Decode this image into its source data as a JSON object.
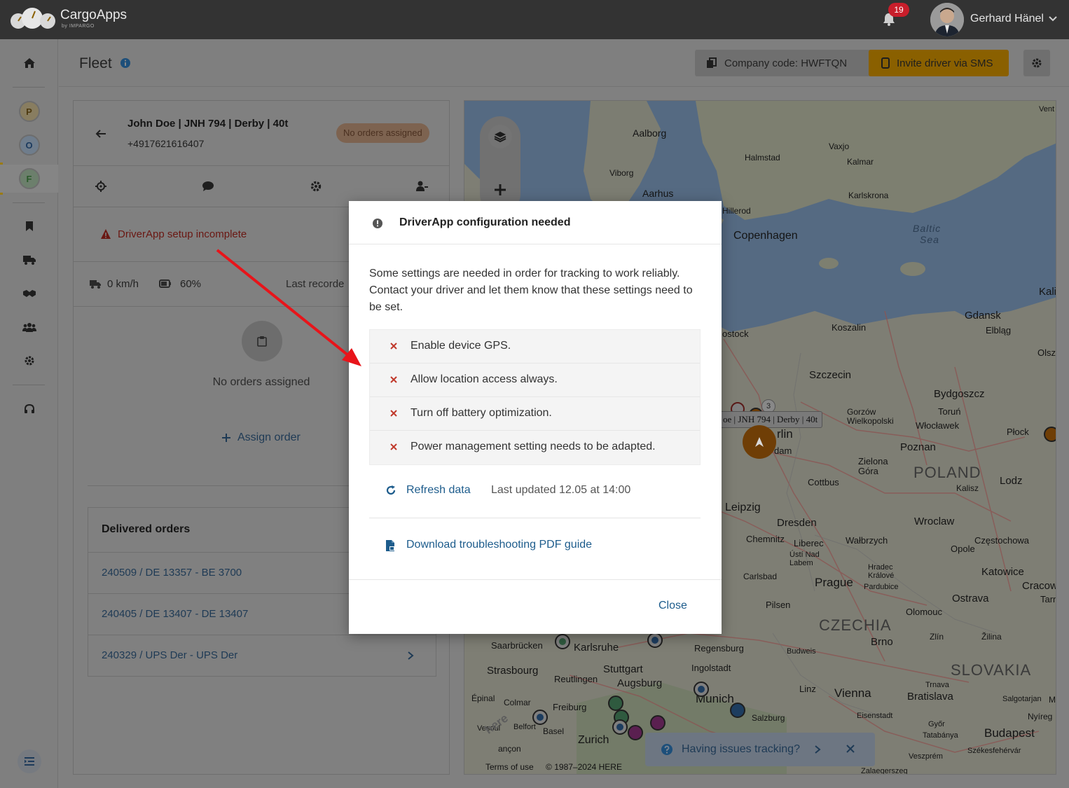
{
  "app": {
    "brand": "CargoApps",
    "brand_sub": "by IMPARGO",
    "notifications_count": "19",
    "user_name": "Gerhard Hänel"
  },
  "sidebar": {
    "letters": [
      {
        "label": "P",
        "color": "#7a6a3a"
      },
      {
        "label": "O",
        "color": "#2a4c6e"
      },
      {
        "label": "F",
        "color": "#3f6b3f"
      }
    ],
    "icons": [
      "home-icon",
      "bookmark-icon",
      "truck-icon",
      "handshake-icon",
      "users-icon",
      "gear-icon",
      "headset-icon",
      "collapse-menu-icon"
    ]
  },
  "header": {
    "title": "Fleet",
    "company_code_label": "Company code: HWFTQN",
    "invite_label": "Invite driver via SMS"
  },
  "panel": {
    "driver_title": "John Doe | JNH 794 | Derby | 40t",
    "phone": "+4917621616407",
    "status_chip": "No orders assigned",
    "warning": "DriverApp setup incomplete",
    "speed": "0 km/h",
    "battery": "60%",
    "last_recorded": "Last recorde",
    "no_orders": "No orders assigned",
    "assign_order": "Assign order",
    "delivered_title": "Delivered orders",
    "delivered_orders": [
      "240509 / DE 13357 - BE 3700",
      "240405 / DE 13407 - DE 13407",
      "240329 / UPS Der - UPS Der"
    ]
  },
  "map": {
    "labels": {
      "aalborg": "Aalborg",
      "viborg": "Viborg",
      "aarhus": "Aarhus",
      "vaxjo": "Vaxjo",
      "halmstad": "Halmstad",
      "kalmar": "Kalmar",
      "karlskrona": "Karlskrona",
      "hillerod": "Hillerod",
      "copenhagen": "Copenhagen",
      "baltic": "Baltic",
      "sea": "Sea",
      "kali": "Kali",
      "gdansk": "Gdansk",
      "elblag": "Elbląg",
      "koszalin": "Koszalin",
      "rostock": "ostock",
      "olsz": "Olszt",
      "szczecin": "Szczecin",
      "bydgoszcz": "Bydgoszcz",
      "gorzow": "Gorzów\nWielkopolski",
      "torun": "Toruń",
      "wloclawek": "Włocławek",
      "plock": "Płock",
      "berlin": "rlin",
      "poznan": "Poznan",
      "potsdam": "dam",
      "zielona": "Zielona\nGóra",
      "poland": "POLAND",
      "lodz": "Lodz",
      "kalisz": "Kalisz",
      "cottbus": "Cottbus",
      "leipzig": "Leipzig",
      "wroclaw": "Wroclaw",
      "dresden": "Dresden",
      "chemnitz": "Chemnitz",
      "liberec": "Liberec",
      "walbrzych": "Wałbrzych",
      "czestochowa": "Częstochowa",
      "opole": "Opole",
      "ustinad": "Ústí Nad\nLabem",
      "hradec": "Hradec\nKrálové",
      "pardubice": "Pardubice",
      "katowice": "Katowice",
      "cracow": "Cracow",
      "carlsbad": "Carlsbad",
      "prague": "Prague",
      "ostrava": "Ostrava",
      "tarn": "Tarn",
      "pilsen": "Pilsen",
      "olomouc": "Olomouc",
      "czechia": "CZECHIA",
      "brno": "Brno",
      "zlin": "Zlín",
      "zilina": "Žilina",
      "saarbrucken": "Saarbrücken",
      "karlsruhe": "Karlsruhe",
      "regensburg": "Regensburg",
      "budweis": "Budweis",
      "slovakia": "SLOVAKIA",
      "strasbourg": "Strasbourg",
      "stuttgart": "Stuttgart",
      "ingolstadt": "Ingolstadt",
      "reutlingen": "Reutlingen",
      "augsburg": "Augsburg",
      "linz": "Linz",
      "vienna": "Vienna",
      "trnava": "Trnava",
      "bratislava": "Bratislava",
      "salgotarjan": "Salgotarjan",
      "epinal": "Épinal",
      "colmar": "Colmar",
      "freiburg": "Freiburg",
      "munich": "Munich",
      "salzburg": "Salzburg",
      "eisenstadt": "Eisenstadt",
      "gyor": "Győr",
      "tatabanya": "Tatabánya",
      "budapest": "Budapest",
      "nyireg": "Nyíreg",
      "vesoul": "Vesoul",
      "belfort": "Belfort",
      "basel": "Basel",
      "zurich": "Zurich",
      "besancon": "ançon",
      "veszprem": "Veszprém",
      "szekesfehervar": "Székesfehérvár",
      "zalaegerszeg": "Zalaegerszeg",
      "vent": "Vent",
      "m": "M",
      "kalisz2": "Kalisz"
    },
    "cluster_count": "3",
    "vehicle_tooltip": "oe | JNH 794 | Derby | 40t",
    "terms": "Terms of use",
    "copyright": "© 1987–2024 HERE",
    "issues_label": "Having issues tracking?",
    "here_watermark": "here"
  },
  "modal": {
    "title": "DriverApp configuration needed",
    "body": "Some settings are needed in order for tracking to work reliably. Contact your driver and let them know that these settings need to be set.",
    "items": [
      "Enable device GPS.",
      "Allow location access always.",
      "Turn off battery optimization.",
      "Power management setting needs to be adapted."
    ],
    "refresh_label": "Refresh data",
    "last_updated": "Last updated 12.05 at 14:00",
    "download_label": "Download troubleshooting PDF guide",
    "close_label": "Close"
  },
  "colors": {
    "accent_yellow": "#f0b400",
    "error_red": "#c0392b",
    "link_blue": "#1d5c8c"
  }
}
